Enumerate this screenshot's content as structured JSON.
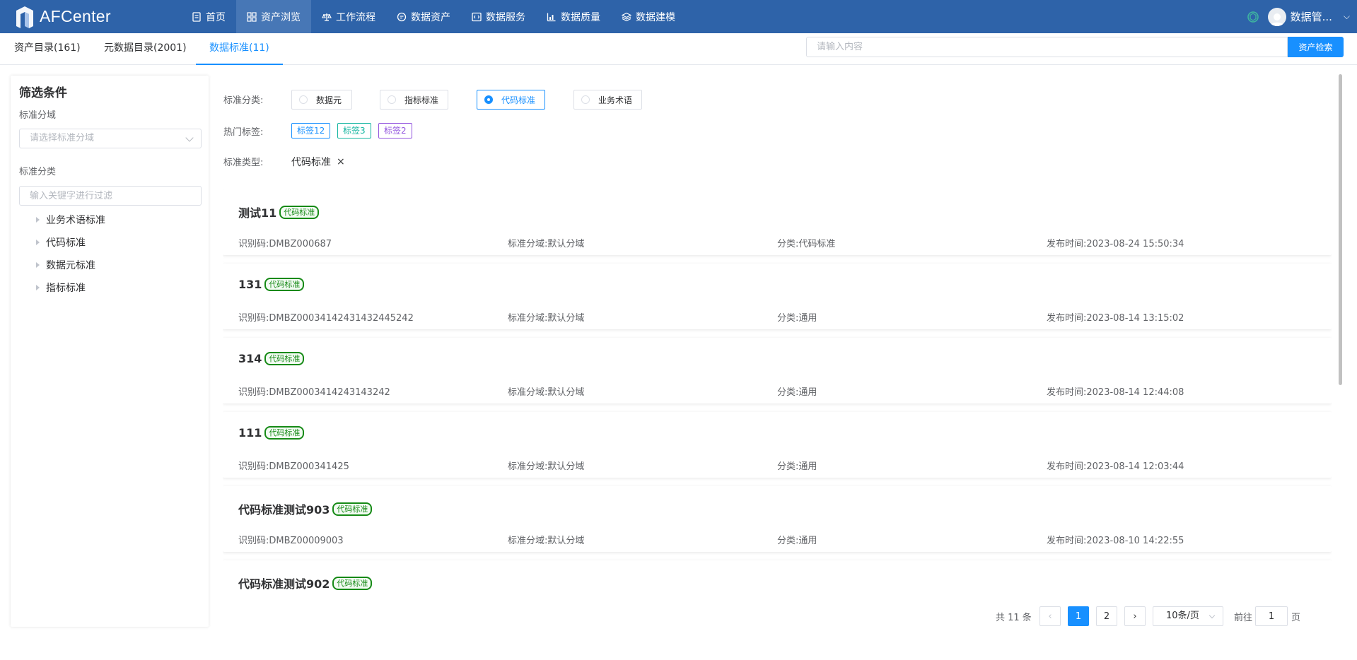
{
  "app": {
    "title": "AFCenter"
  },
  "nav": {
    "items": [
      {
        "label": "首页",
        "icon": "document-icon"
      },
      {
        "label": "资产浏览",
        "icon": "grid-icon",
        "active": true
      },
      {
        "label": "工作流程",
        "icon": "scale-icon"
      },
      {
        "label": "数据资产",
        "icon": "chat-icon"
      },
      {
        "label": "数据服务",
        "icon": "code-icon"
      },
      {
        "label": "数据质量",
        "icon": "bar-chart-icon"
      },
      {
        "label": "数据建模",
        "icon": "layers-icon"
      }
    ],
    "user": {
      "name": "数据管..."
    }
  },
  "tabs": [
    {
      "label": "资产目录(161)"
    },
    {
      "label": "元数据目录(2001)"
    },
    {
      "label": "数据标准(11)",
      "active": true
    }
  ],
  "search": {
    "placeholder": "请输入内容",
    "button": "资产检索"
  },
  "filter_panel": {
    "title": "筛选条件",
    "domain_label": "标准分域",
    "domain_placeholder": "请选择标准分域",
    "category_label": "标准分类",
    "category_placeholder": "输入关键字进行过滤",
    "tree": [
      "业务术语标准",
      "代码标准",
      "数据元标准",
      "指标标准"
    ]
  },
  "filters": {
    "category_label": "标准分类:",
    "category_options": [
      {
        "label": "数据元",
        "checked": false
      },
      {
        "label": "指标标准",
        "checked": false
      },
      {
        "label": "代码标准",
        "checked": true
      },
      {
        "label": "业务术语",
        "checked": false
      }
    ],
    "hot_label": "热门标签:",
    "hot_tags": [
      {
        "label": "标签12",
        "color": "#1890ff"
      },
      {
        "label": "标签3",
        "color": "#13b5a0"
      },
      {
        "label": "标签2",
        "color": "#9254de"
      }
    ],
    "type_label": "标准类型:",
    "type_chip": "代码标准",
    "type_chip_close": "×"
  },
  "results": [
    {
      "title": "测试11",
      "badge": "代码标准",
      "code": "识别码:DMBZ000687",
      "domain": "标准分域:默认分域",
      "category": "分类:代码标准",
      "published": "发布时间:2023-08-24 15:50:34"
    },
    {
      "title": "131",
      "badge": "代码标准",
      "code": "识别码:DMBZ00034142431432445242",
      "domain": "标准分域:默认分域",
      "category": "分类:通用",
      "published": "发布时间:2023-08-14 13:15:02"
    },
    {
      "title": "314",
      "badge": "代码标准",
      "code": "识别码:DMBZ0003414243143242",
      "domain": "标准分域:默认分域",
      "category": "分类:通用",
      "published": "发布时间:2023-08-14 12:44:08"
    },
    {
      "title": "111",
      "badge": "代码标准",
      "code": "识别码:DMBZ000341425",
      "domain": "标准分域:默认分域",
      "category": "分类:通用",
      "published": "发布时间:2023-08-14 12:03:44"
    },
    {
      "title": "代码标准测试903",
      "badge": "代码标准",
      "code": "识别码:DMBZ00009003",
      "domain": "标准分域:默认分域",
      "category": "分类:通用",
      "published": "发布时间:2023-08-10 14:22:55"
    },
    {
      "title": "代码标准测试902",
      "badge": "代码标准",
      "code": "",
      "domain": "",
      "category": "",
      "published": ""
    }
  ],
  "pagination": {
    "total": "共 11 条",
    "prev": "‹",
    "pages": [
      "1",
      "2"
    ],
    "current": "1",
    "next": "›",
    "page_size": "10条/页",
    "goto_label": "前往",
    "goto_value": "1",
    "goto_suffix": "页"
  },
  "colors": {
    "nav_bg": "#2e63a9",
    "primary": "#1890ff",
    "badge_green": "#168a16"
  }
}
